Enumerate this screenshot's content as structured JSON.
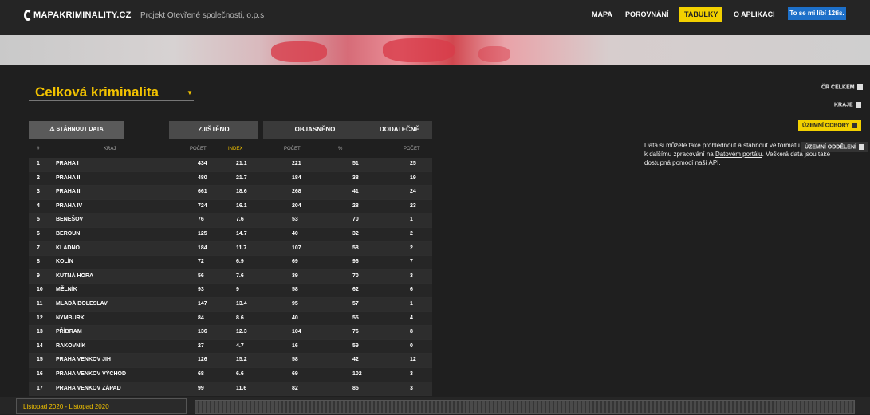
{
  "header": {
    "logo": "MAPAKRIMINALITY.CZ",
    "project": "Projekt Otevřené společnosti, o.p.s",
    "nav": [
      "MAPA",
      "POROVNÁNÍ",
      "TABULKY",
      "O APLIKACI"
    ],
    "active_nav": "TABULKY",
    "facebook": "To se mi líbí 12tis."
  },
  "title": "Celková kriminalita",
  "right_panel": {
    "cr_button": "ČR CELKEM",
    "kraje_button": "KRAJE",
    "uzemni_odbory_button": "ÚZEMNÍ ODBORY",
    "uzemni_oddeleni_button": "ÚZEMNÍ ODDĚLENÍ",
    "info_pre": "Data si můžete také prohlédnout a stáhnout ve formátu vhodném k dalšímu zpracování na ",
    "info_link1": "Datovém portálu",
    "info_mid": ". Veškerá data jsou také dostupná pomocí naší ",
    "info_link2": "API",
    "info_post": "."
  },
  "table": {
    "export_label": "STÁHNOUT DATA",
    "groups": [
      "ZJIŠTĚNO",
      "OBJASNĚNO",
      "DODATEČNĚ"
    ],
    "columns": [
      "#",
      "KRAJ",
      "POČET",
      "INDEX",
      "POČET",
      "%",
      "POČET"
    ],
    "rows": [
      [
        "1",
        "PRAHA I",
        "434",
        "21.1",
        "221",
        "51",
        "25"
      ],
      [
        "2",
        "PRAHA II",
        "480",
        "21.7",
        "184",
        "38",
        "19"
      ],
      [
        "3",
        "PRAHA III",
        "661",
        "18.6",
        "268",
        "41",
        "24"
      ],
      [
        "4",
        "PRAHA IV",
        "724",
        "16.1",
        "204",
        "28",
        "23"
      ],
      [
        "5",
        "BENEŠOV",
        "76",
        "7.6",
        "53",
        "70",
        "1"
      ],
      [
        "6",
        "BEROUN",
        "125",
        "14.7",
        "40",
        "32",
        "2"
      ],
      [
        "7",
        "KLADNO",
        "184",
        "11.7",
        "107",
        "58",
        "2"
      ],
      [
        "8",
        "KOLÍN",
        "72",
        "6.9",
        "69",
        "96",
        "7"
      ],
      [
        "9",
        "KUTNÁ HORA",
        "56",
        "7.6",
        "39",
        "70",
        "3"
      ],
      [
        "10",
        "MĚLNÍK",
        "93",
        "9",
        "58",
        "62",
        "6"
      ],
      [
        "11",
        "MLADÁ BOLESLAV",
        "147",
        "13.4",
        "95",
        "57",
        "1"
      ],
      [
        "12",
        "NYMBURK",
        "84",
        "8.6",
        "40",
        "55",
        "4"
      ],
      [
        "13",
        "PŘÍBRAM",
        "136",
        "12.3",
        "104",
        "76",
        "8"
      ],
      [
        "14",
        "RAKOVNÍK",
        "27",
        "4.7",
        "16",
        "59",
        "0"
      ],
      [
        "15",
        "PRAHA VENKOV JIH",
        "126",
        "15.2",
        "58",
        "42",
        "12"
      ],
      [
        "16",
        "PRAHA VENKOV VÝCHOD",
        "68",
        "6.6",
        "69",
        "102",
        "3"
      ],
      [
        "17",
        "PRAHA VENKOV ZÁPAD",
        "99",
        "11.6",
        "82",
        "85",
        "3"
      ]
    ]
  },
  "period": "Listopad 2020 - Listopad 2020",
  "colors": {
    "accent": "#f2c200",
    "active_nav": "#f2d000",
    "facebook": "#1d70c9"
  }
}
